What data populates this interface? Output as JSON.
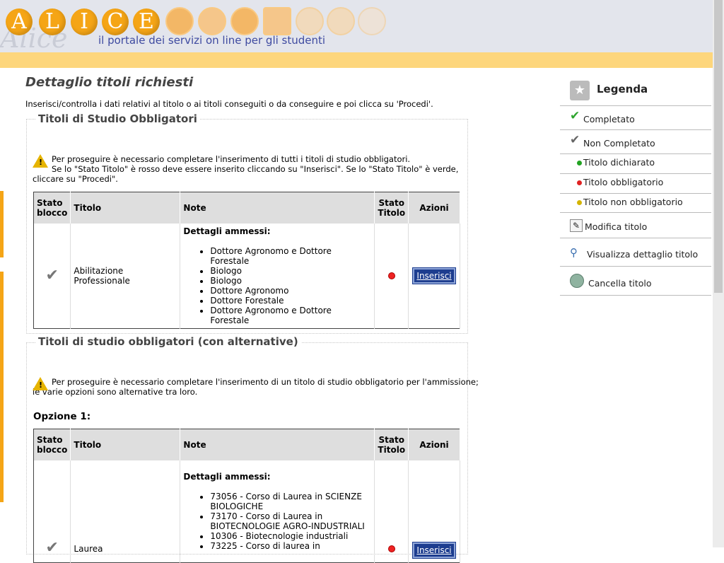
{
  "header": {
    "letters": [
      "A",
      "L",
      "I",
      "C",
      "E"
    ],
    "script": "Alice",
    "tagline": "il portale dei servizi on line per gli studenti"
  },
  "page": {
    "title": "Dettaglio titoli richiesti",
    "intro": "Inserisci/controlla i dati relativi al titolo o ai titoli conseguiti o da conseguire e poi clicca su 'Procedi'."
  },
  "section1": {
    "legend": "Titoli di Studio Obbligatori",
    "warn1": "Per proseguire è necessario completare l'inserimento di tutti i titoli di studio obbligatori.",
    "warn2": "Se lo \"Stato Titolo\" è rosso deve essere inserito cliccando su \"Inserisci\". Se lo \"Stato Titolo\" è verde,",
    "warn3": "cliccare su \"Procedi\".",
    "row": {
      "titolo": "Abilitazione Professionale",
      "dettagli": "Dettagli ammessi:",
      "items": [
        "Dottore Agronomo e Dottore Forestale",
        "Biologo",
        "Biologo",
        "Dottore Agronomo",
        "Dottore Forestale",
        "Dottore Agronomo e Dottore Forestale"
      ],
      "button": "Inserisci"
    }
  },
  "table_headers": {
    "stato_blocco_1": "Stato",
    "stato_blocco_2": "blocco",
    "titolo": "Titolo",
    "note": "Note",
    "stato_titolo_1": "Stato",
    "stato_titolo_2": "Titolo",
    "azioni": "Azioni"
  },
  "section2": {
    "legend": "Titoli di studio obbligatori (con alternative)",
    "warn1": "Per proseguire è necessario completare l'inserimento di un titolo di studio obbligatorio per l'ammissione;",
    "warn2": "le varie opzioni sono alternative tra loro.",
    "option": "Opzione 1:",
    "row": {
      "titolo": "Laurea",
      "dettagli": "Dettagli ammessi:",
      "items": [
        "73056 - Corso di Laurea in SCIENZE BIOLOGICHE",
        "73170 - Corso di Laurea in BIOTECNOLOGIE AGRO-INDUSTRIALI",
        "10306 - Biotecnologie industriali",
        "73225 - Corso di laurea in"
      ],
      "button": "Inserisci"
    }
  },
  "legend": {
    "title": "Legenda",
    "items": [
      {
        "label": "Completato",
        "color": "#2fa52f"
      },
      {
        "label": "Non Completato",
        "color": "#666666"
      },
      {
        "label": "Titolo dichiarato",
        "color": "#22a322"
      },
      {
        "label": "Titolo obbligatorio",
        "color": "#e02222"
      },
      {
        "label": "Titolo non obbligatorio",
        "color": "#d4b400"
      },
      {
        "label": "Modifica titolo"
      },
      {
        "label": "Visualizza dettaglio titolo"
      },
      {
        "label": "Cancella titolo"
      }
    ]
  }
}
